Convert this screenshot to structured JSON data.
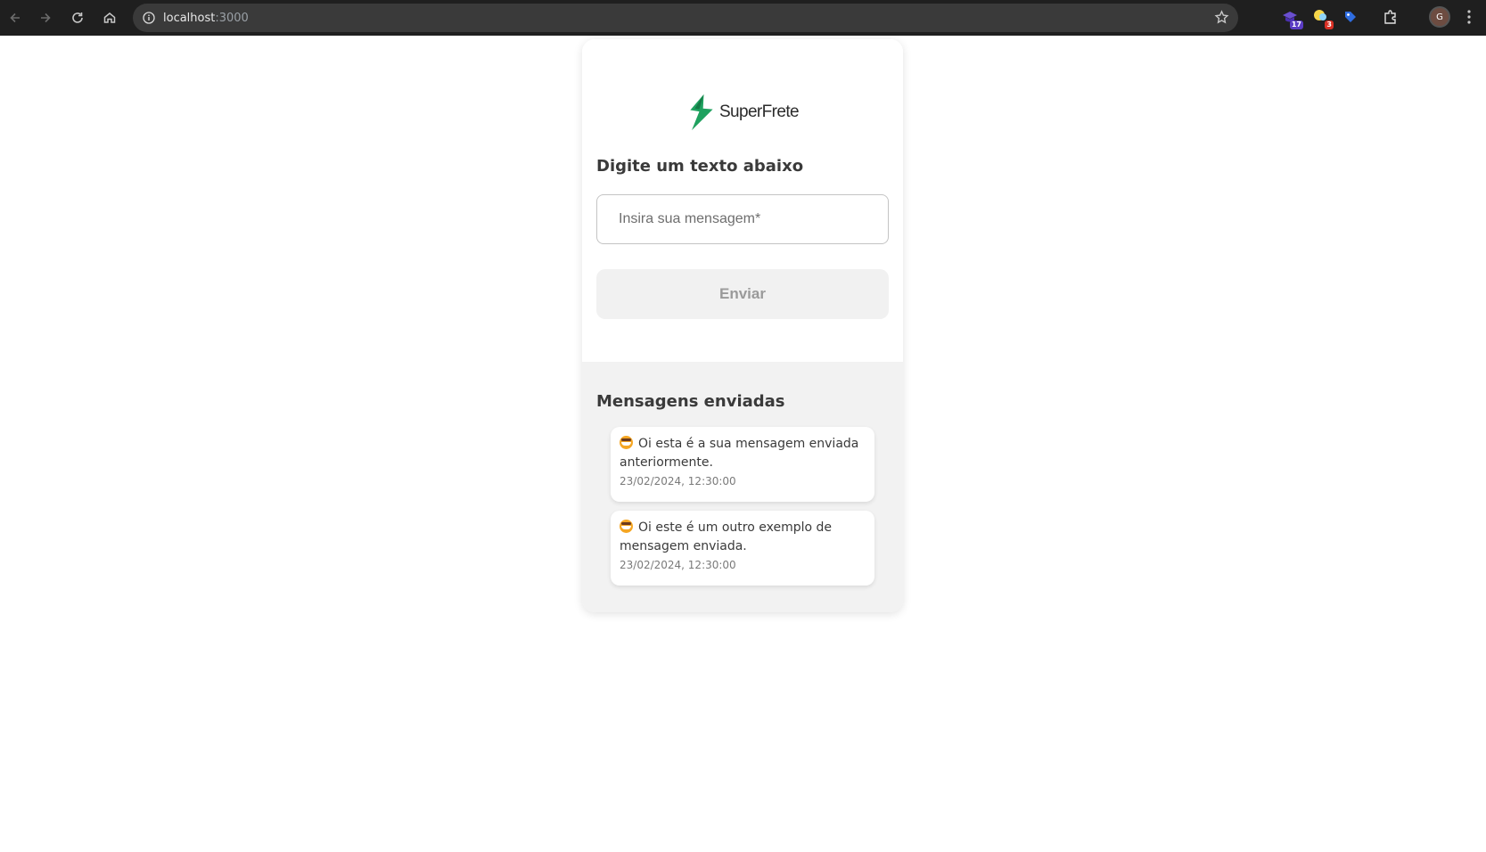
{
  "browser": {
    "url_host": "localhost",
    "url_port": ":3000",
    "extensions": [
      {
        "icon": "hat-extension-icon",
        "badge": "17",
        "badge_color": "#5b3cc4"
      },
      {
        "icon": "bulb-extension-icon",
        "badge": "3",
        "badge_color": "#d93025"
      },
      {
        "icon": "tag-extension-icon",
        "badge": ""
      }
    ],
    "profile_initial": "G"
  },
  "app": {
    "brand_name": "SuperFrete",
    "brand_color": "#1fa15f",
    "form_title": "Digite um texto abaixo",
    "input_placeholder": "Insira sua mensagem*",
    "input_value": "",
    "send_label": "Enviar",
    "sent_title": "Mensagens enviadas",
    "messages": [
      {
        "text": "Oi esta é a sua mensagem enviada anteriormente.",
        "date": "23/02/2024, 12:30:00",
        "emoji": "grinning-face-icon"
      },
      {
        "text": "Oi este é um outro exemplo de mensagem enviada.",
        "date": "23/02/2024, 12:30:00",
        "emoji": "grinning-face-icon"
      }
    ]
  }
}
